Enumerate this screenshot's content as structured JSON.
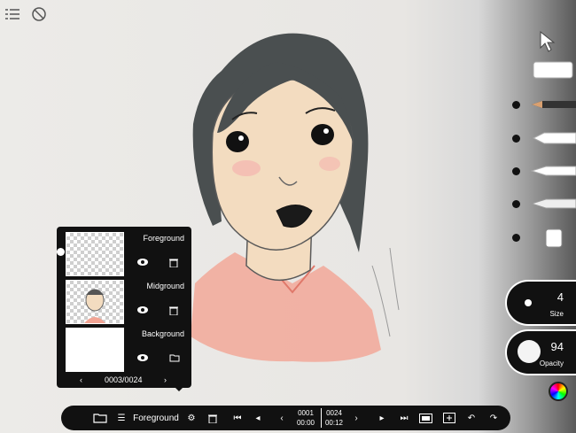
{
  "layers_panel": {
    "layers": [
      {
        "name": "Foreground"
      },
      {
        "name": "Midground"
      },
      {
        "name": "Background"
      }
    ],
    "frame_counter": "0003/0024"
  },
  "toolbar_right": {
    "size": {
      "value": "4",
      "label": "Size"
    },
    "opacity": {
      "value": "94",
      "label": "Opacity"
    }
  },
  "bottom_bar": {
    "layer_name": "Foreground",
    "current_frame": "0001",
    "current_time": "00:00",
    "total_frames": "0024",
    "total_time": "00:12"
  },
  "colors": {
    "panel": "#111111",
    "hair": "#4a4f50",
    "skin": "#f3dcc0",
    "shirt": "#f2a494"
  }
}
